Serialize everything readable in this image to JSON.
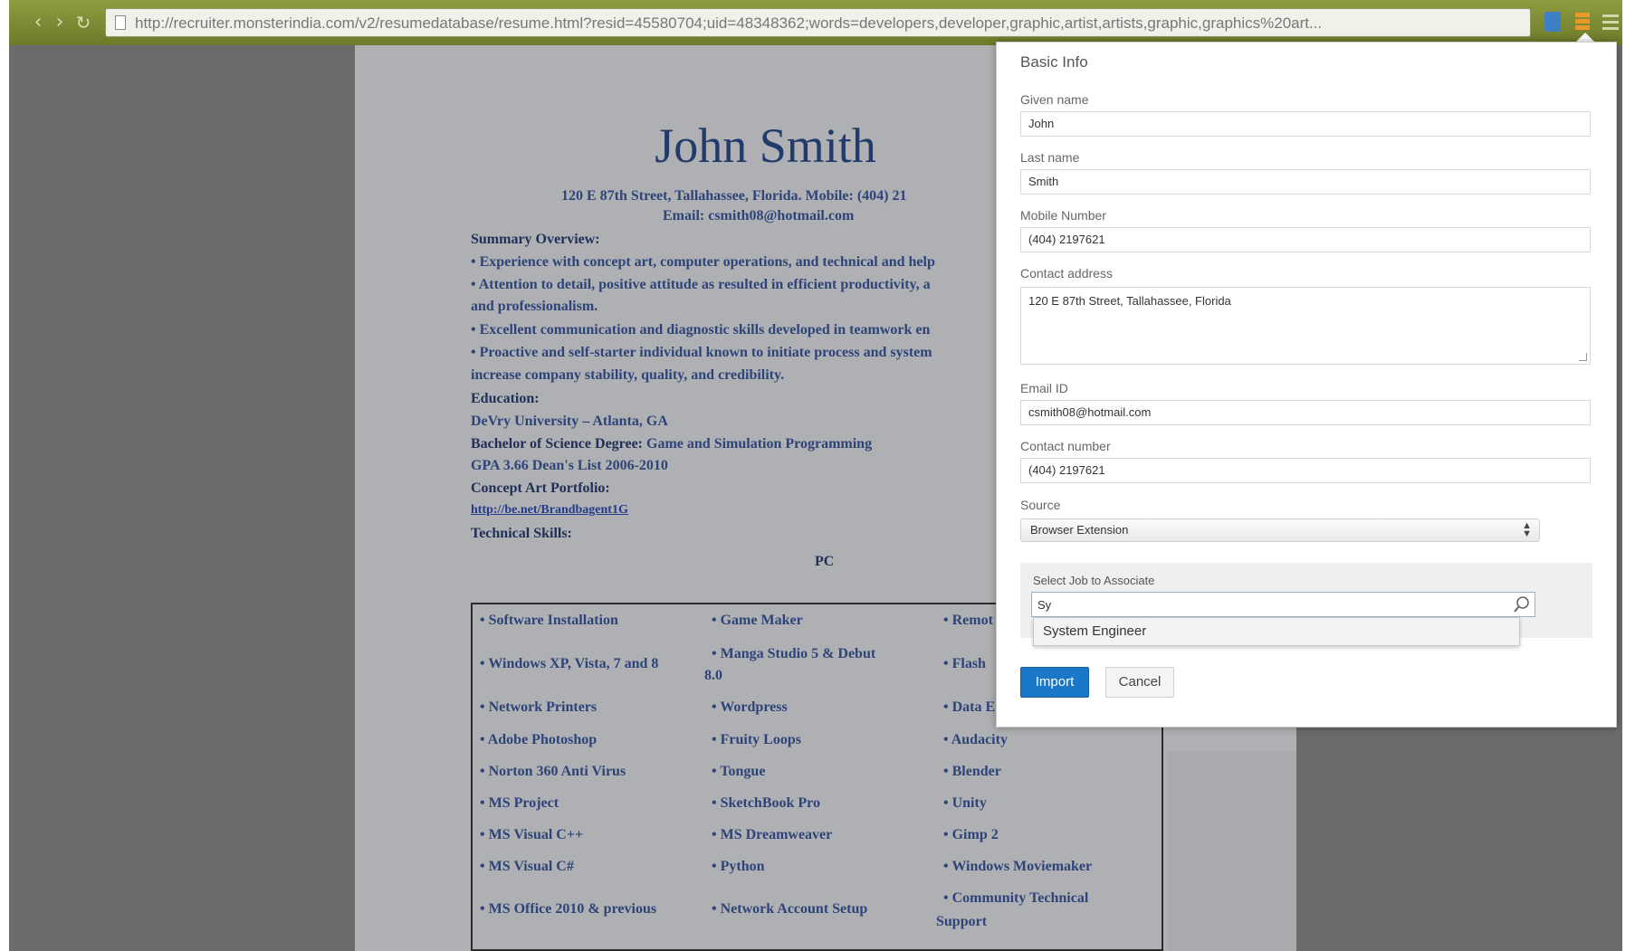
{
  "browser": {
    "url": "http://recruiter.monsterindia.com/v2/resumedatabase/resume.html?resid=45580704;uid=48348362;words=developers,developer,graphic,artist,artists,graphic,graphics%20art..."
  },
  "resume": {
    "name": "John Smith",
    "address": "120 E 87th Street, Tallahassee, Florida. Mobile: (404) 21",
    "email": "Email: csmith08@hotmail.com",
    "summary_heading": "Summary Overview:",
    "summary_items": [
      "• Experience with concept art, computer operations, and technical and help",
      "• Attention to detail, positive attitude as resulted in efficient productivity, a",
      "and professionalism.",
      "• Excellent communication and diagnostic skills developed in teamwork en",
      "• Proactive and self-starter individual known to initiate process and system",
      "increase company stability, quality, and credibility."
    ],
    "education_heading": "Education:",
    "university": "DeVry University – Atlanta, GA",
    "degree_label": "Bachelor of Science Degree:",
    "degree_value": "Game and Simulation Programming",
    "gpa": "GPA 3.66     Dean's List 2006-2010",
    "portfolio_heading": "Concept Art Portfolio:",
    "portfolio_link": "http://be.net/Brandbagent1G",
    "skills_heading": "Technical Skills:",
    "skills_subheading": "PC",
    "skills": {
      "col1": [
        "• Software Installation",
        "• Windows XP, Vista, 7 and 8",
        "• Network Printers",
        "• Adobe Photoshop",
        "• Norton 360 Anti Virus",
        "• MS Project",
        "• MS Visual C++",
        "• MS Visual C#",
        "• MS Office 2010 & previous"
      ],
      "col2a": [
        "• Game Maker",
        "• Manga Studio 5 & Debut",
        "8.0"
      ],
      "col2": [
        "• Wordpress",
        "• Fruity Loops",
        "• Tongue",
        "• SketchBook Pro",
        "• MS Dreamweaver",
        "• Python",
        "• Network Account Setup"
      ],
      "col3": [
        "• Remot",
        "• Flash",
        "• Data E",
        "• Audacity",
        "• Blender",
        "• Unity",
        "• Gimp 2",
        "• Windows Moviemaker",
        "• Community Technical",
        "Support"
      ]
    }
  },
  "popup": {
    "title": "Basic Info",
    "given_name_label": "Given name",
    "given_name": "John",
    "last_name_label": "Last name",
    "last_name": "Smith",
    "mobile_label": "Mobile Number",
    "mobile": "(404) 2197621",
    "address_label": "Contact address",
    "address": "120 E 87th Street, Tallahassee, Florida",
    "email_label": "Email ID",
    "email": "csmith08@hotmail.com",
    "contact_label": "Contact number",
    "contact": "(404) 2197621",
    "source_label": "Source",
    "source_value": "Browser Extension",
    "job_label": "Select Job to Associate",
    "job_query": "Sy",
    "job_option": "System Engineer",
    "import_label": "Import",
    "cancel_label": "Cancel"
  },
  "colors": {
    "accent": "#1b78c8",
    "toolbar": "#7c8a33"
  }
}
